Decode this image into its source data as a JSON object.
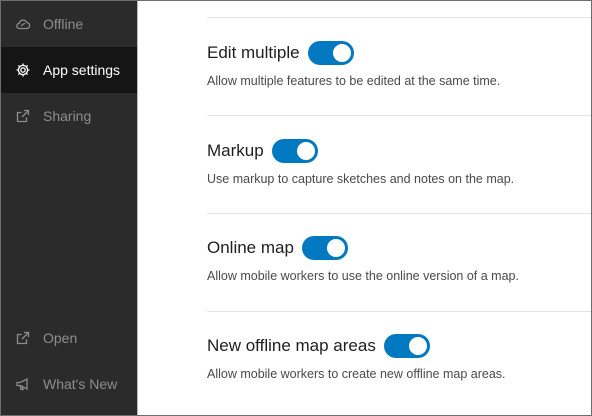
{
  "sidebar": {
    "items": [
      {
        "label": "Offline",
        "icon": "cloud-offline-icon",
        "active": false
      },
      {
        "label": "App settings",
        "icon": "gear-icon",
        "active": true
      },
      {
        "label": "Sharing",
        "icon": "share-icon",
        "active": false
      },
      {
        "label": "Open",
        "icon": "open-external-icon",
        "active": false
      },
      {
        "label": "What's New",
        "icon": "megaphone-icon",
        "active": false
      }
    ]
  },
  "settings": [
    {
      "title": "Edit multiple",
      "description": "Allow multiple features to be edited at the same time.",
      "enabled": true
    },
    {
      "title": "Markup",
      "description": "Use markup to capture sketches and notes on the map.",
      "enabled": true
    },
    {
      "title": "Online map",
      "description": "Allow mobile workers to use the online version of a map.",
      "enabled": true
    },
    {
      "title": "New offline map areas",
      "description": "Allow mobile workers to create new offline map areas.",
      "enabled": true
    }
  ],
  "colors": {
    "sidebar_bg": "#2b2b2b",
    "sidebar_active_bg": "#151515",
    "toggle_on": "#0079c1"
  }
}
